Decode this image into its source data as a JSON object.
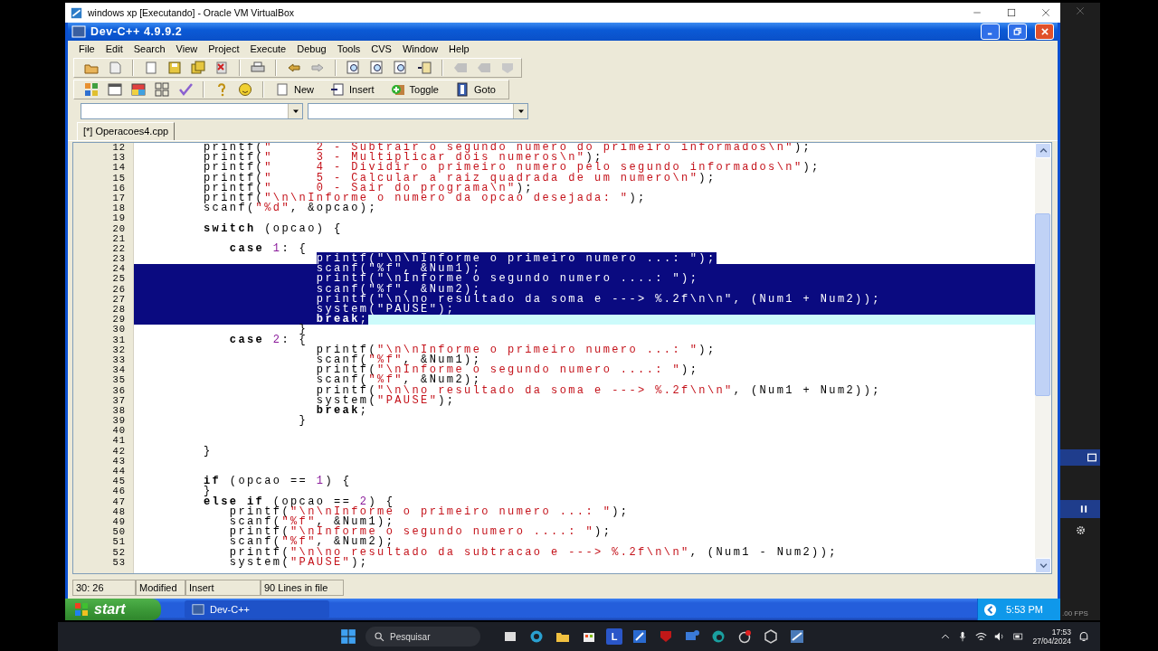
{
  "host_window": {
    "title": "windows xp [Executando] - Oracle VM VirtualBox"
  },
  "app": {
    "title": "Dev-C++ 4.9.9.2",
    "menu": [
      "File",
      "Edit",
      "Search",
      "View",
      "Project",
      "Execute",
      "Debug",
      "Tools",
      "CVS",
      "Window",
      "Help"
    ],
    "toolbar_buttons": [
      "New",
      "Insert",
      "Toggle",
      "Goto"
    ],
    "tabs": [
      {
        "label": "[*] Operacoes4.cpp",
        "selected": true
      }
    ],
    "editor": {
      "lines": [
        {
          "number": "12",
          "selected": false,
          "current": false,
          "segments": [
            {
              "kind": "plain",
              "text": "printf("
            },
            {
              "kind": "string",
              "text": "\"     2 - Subtrair o segundo numero do primeiro informados\\n\""
            },
            {
              "kind": "plain",
              "text": ");"
            }
          ]
        },
        {
          "number": "13",
          "selected": false,
          "current": false,
          "segments": [
            {
              "kind": "plain",
              "text": "printf("
            },
            {
              "kind": "string",
              "text": "\"     3 - Multiplicar dois numeros\\n\""
            },
            {
              "kind": "plain",
              "text": ");"
            }
          ]
        },
        {
          "number": "14",
          "selected": false,
          "current": false,
          "segments": [
            {
              "kind": "plain",
              "text": "printf("
            },
            {
              "kind": "string",
              "text": "\"     4 - Dividir o primeiro numero pelo segundo informados\\n\""
            },
            {
              "kind": "plain",
              "text": ");"
            }
          ]
        },
        {
          "number": "15",
          "selected": false,
          "current": false,
          "segments": [
            {
              "kind": "plain",
              "text": "printf("
            },
            {
              "kind": "string",
              "text": "\"     5 - Calcular a raiz quadrada de um numero\\n\""
            },
            {
              "kind": "plain",
              "text": ");"
            }
          ]
        },
        {
          "number": "16",
          "selected": false,
          "current": false,
          "segments": [
            {
              "kind": "plain",
              "text": "printf("
            },
            {
              "kind": "string",
              "text": "\"     0 - Sair do programa\\n\""
            },
            {
              "kind": "plain",
              "text": ");"
            }
          ]
        },
        {
          "number": "17",
          "selected": false,
          "current": false,
          "segments": [
            {
              "kind": "plain",
              "text": "printf("
            },
            {
              "kind": "string",
              "text": "\"\\n\\nInforme o numero da opcao desejada: \""
            },
            {
              "kind": "plain",
              "text": ");"
            }
          ]
        },
        {
          "number": "18",
          "selected": false,
          "current": false,
          "segments": [
            {
              "kind": "plain",
              "text": "scanf("
            },
            {
              "kind": "string",
              "text": "\"%d\""
            },
            {
              "kind": "plain",
              "text": ", &opcao);"
            }
          ]
        },
        {
          "number": "19",
          "selected": false,
          "current": false
        },
        {
          "number": "20",
          "selected": false,
          "current": false,
          "segments": [
            {
              "kind": "keyword",
              "text": "switch"
            },
            {
              "kind": "plain",
              "text": " (opcao) {"
            }
          ]
        },
        {
          "number": "21",
          "selected": false,
          "current": false
        },
        {
          "number": "22",
          "selected": false,
          "current": false,
          "segments": [
            {
              "kind": "keyword",
              "text": "   case"
            },
            {
              "kind": "number",
              "text": " 1"
            },
            {
              "kind": "plain",
              "text": ": {"
            }
          ]
        },
        {
          "number": "23",
          "selected": true,
          "current": false,
          "segments": [
            {
              "kind": "plain",
              "text": "             printf("
            },
            {
              "kind": "string",
              "text": "\"\\n\\nInforme o primeiro numero ...: \""
            },
            {
              "kind": "plain",
              "text": ");"
            }
          ]
        },
        {
          "number": "24",
          "selected": true,
          "current": false,
          "segments": [
            {
              "kind": "plain",
              "text": "             scanf("
            },
            {
              "kind": "string",
              "text": "\"%f\""
            },
            {
              "kind": "plain",
              "text": ", &Num1);"
            }
          ]
        },
        {
          "number": "25",
          "selected": true,
          "current": false,
          "segments": [
            {
              "kind": "plain",
              "text": "             printf("
            },
            {
              "kind": "string",
              "text": "\"\\nInforme o segundo numero ....: \""
            },
            {
              "kind": "plain",
              "text": ");"
            }
          ]
        },
        {
          "number": "26",
          "selected": true,
          "current": false,
          "segments": [
            {
              "kind": "plain",
              "text": "             scanf("
            },
            {
              "kind": "string",
              "text": "\"%f\""
            },
            {
              "kind": "plain",
              "text": ", &Num2);"
            }
          ]
        },
        {
          "number": "27",
          "selected": true,
          "current": false,
          "segments": [
            {
              "kind": "plain",
              "text": "             printf("
            },
            {
              "kind": "string",
              "text": "\"\\n\\no resultado da soma e ---> %.2f\\n\\n\""
            },
            {
              "kind": "plain",
              "text": ", (Num1 + Num2));"
            }
          ]
        },
        {
          "number": "28",
          "selected": true,
          "current": false,
          "segments": [
            {
              "kind": "plain",
              "text": "             system("
            },
            {
              "kind": "string",
              "text": "\"PAUSE\""
            },
            {
              "kind": "plain",
              "text": ");"
            }
          ]
        },
        {
          "number": "29",
          "selected": true,
          "current": true,
          "segments": [
            {
              "kind": "keyword",
              "text": "             break"
            },
            {
              "kind": "plain",
              "text": ";"
            }
          ]
        },
        {
          "number": "30",
          "selected": false,
          "current": false,
          "segments": [
            {
              "kind": "plain",
              "text": "           }"
            }
          ]
        },
        {
          "number": "31",
          "selected": false,
          "current": false,
          "segments": [
            {
              "kind": "keyword",
              "text": "   case"
            },
            {
              "kind": "number",
              "text": " 2"
            },
            {
              "kind": "plain",
              "text": ": {"
            }
          ]
        },
        {
          "number": "32",
          "selected": false,
          "current": false,
          "segments": [
            {
              "kind": "plain",
              "text": "             printf("
            },
            {
              "kind": "string",
              "text": "\"\\n\\nInforme o primeiro numero ...: \""
            },
            {
              "kind": "plain",
              "text": ");"
            }
          ]
        },
        {
          "number": "33",
          "selected": false,
          "current": false,
          "segments": [
            {
              "kind": "plain",
              "text": "             scanf("
            },
            {
              "kind": "string",
              "text": "\"%f\""
            },
            {
              "kind": "plain",
              "text": ", &Num1);"
            }
          ]
        },
        {
          "number": "34",
          "selected": false,
          "current": false,
          "segments": [
            {
              "kind": "plain",
              "text": "             printf("
            },
            {
              "kind": "string",
              "text": "\"\\nInforme o segundo numero ....: \""
            },
            {
              "kind": "plain",
              "text": ");"
            }
          ]
        },
        {
          "number": "35",
          "selected": false,
          "current": false,
          "segments": [
            {
              "kind": "plain",
              "text": "             scanf("
            },
            {
              "kind": "string",
              "text": "\"%f\""
            },
            {
              "kind": "plain",
              "text": ", &Num2);"
            }
          ]
        },
        {
          "number": "36",
          "selected": false,
          "current": false,
          "segments": [
            {
              "kind": "plain",
              "text": "             printf("
            },
            {
              "kind": "string",
              "text": "\"\\n\\no resultado da soma e ---> %.2f\\n\\n\""
            },
            {
              "kind": "plain",
              "text": ", (Num1 + Num2));"
            }
          ]
        },
        {
          "number": "37",
          "selected": false,
          "current": false,
          "segments": [
            {
              "kind": "plain",
              "text": "             system("
            },
            {
              "kind": "string",
              "text": "\"PAUSE\""
            },
            {
              "kind": "plain",
              "text": ");"
            }
          ]
        },
        {
          "number": "38",
          "selected": false,
          "current": false,
          "segments": [
            {
              "kind": "keyword",
              "text": "             break"
            },
            {
              "kind": "plain",
              "text": ";"
            }
          ]
        },
        {
          "number": "39",
          "selected": false,
          "current": false,
          "segments": [
            {
              "kind": "plain",
              "text": "           }"
            }
          ]
        },
        {
          "number": "40",
          "selected": false,
          "current": false
        },
        {
          "number": "41",
          "selected": false,
          "current": false
        },
        {
          "number": "42",
          "selected": false,
          "current": false,
          "segments": [
            {
              "kind": "plain",
              "text": "}"
            }
          ]
        },
        {
          "number": "43",
          "selected": false,
          "current": false
        },
        {
          "number": "44",
          "selected": false,
          "current": false
        },
        {
          "number": "45",
          "selected": false,
          "current": false,
          "segments": [
            {
              "kind": "keyword",
              "text": "if"
            },
            {
              "kind": "plain",
              "text": " (opcao == "
            },
            {
              "kind": "number",
              "text": "1"
            },
            {
              "kind": "plain",
              "text": ") {"
            }
          ]
        },
        {
          "number": "46",
          "selected": false,
          "current": false,
          "segments": [
            {
              "kind": "plain",
              "text": "}"
            }
          ]
        },
        {
          "number": "47",
          "selected": false,
          "current": false,
          "segments": [
            {
              "kind": "keyword",
              "text": "else if"
            },
            {
              "kind": "plain",
              "text": " (opcao == "
            },
            {
              "kind": "number",
              "text": "2"
            },
            {
              "kind": "plain",
              "text": ") {"
            }
          ]
        },
        {
          "number": "48",
          "selected": false,
          "current": false,
          "segments": [
            {
              "kind": "plain",
              "text": "   printf("
            },
            {
              "kind": "string",
              "text": "\"\\n\\nInforme o primeiro numero ...: \""
            },
            {
              "kind": "plain",
              "text": ");"
            }
          ]
        },
        {
          "number": "49",
          "selected": false,
          "current": false,
          "segments": [
            {
              "kind": "plain",
              "text": "   scanf("
            },
            {
              "kind": "string",
              "text": "\"%f\""
            },
            {
              "kind": "plain",
              "text": ", &Num1);"
            }
          ]
        },
        {
          "number": "50",
          "selected": false,
          "current": false,
          "segments": [
            {
              "kind": "plain",
              "text": "   printf("
            },
            {
              "kind": "string",
              "text": "\"\\nInforme o segundo numero ....: \""
            },
            {
              "kind": "plain",
              "text": ");"
            }
          ]
        },
        {
          "number": "51",
          "selected": false,
          "current": false,
          "segments": [
            {
              "kind": "plain",
              "text": "   scanf("
            },
            {
              "kind": "string",
              "text": "\"%f\""
            },
            {
              "kind": "plain",
              "text": ", &Num2);"
            }
          ]
        },
        {
          "number": "52",
          "selected": false,
          "current": false,
          "segments": [
            {
              "kind": "plain",
              "text": "   printf("
            },
            {
              "kind": "string",
              "text": "\"\\n\\no resultado da subtracao e ---> %.2f\\n\\n\""
            },
            {
              "kind": "plain",
              "text": ", (Num1 - Num2));"
            }
          ]
        },
        {
          "number": "53",
          "selected": false,
          "current": false,
          "segments": [
            {
              "kind": "plain",
              "text": "   system("
            },
            {
              "kind": "string",
              "text": "\"PAUSE\""
            },
            {
              "kind": "plain",
              "text": ");"
            }
          ]
        }
      ]
    },
    "status_bar": [
      "30: 26",
      "Modified",
      "Insert",
      "90 Lines in file"
    ]
  },
  "xp_taskbar": {
    "start": "start",
    "tasks": [
      "Dev-C++"
    ],
    "clock": "5:53 PM"
  },
  "fps": ".00 FPS",
  "host_taskbar": {
    "search_placeholder": "Pesquisar",
    "letter_tile": "L",
    "time": "17:53",
    "date": "27/04/2024"
  }
}
